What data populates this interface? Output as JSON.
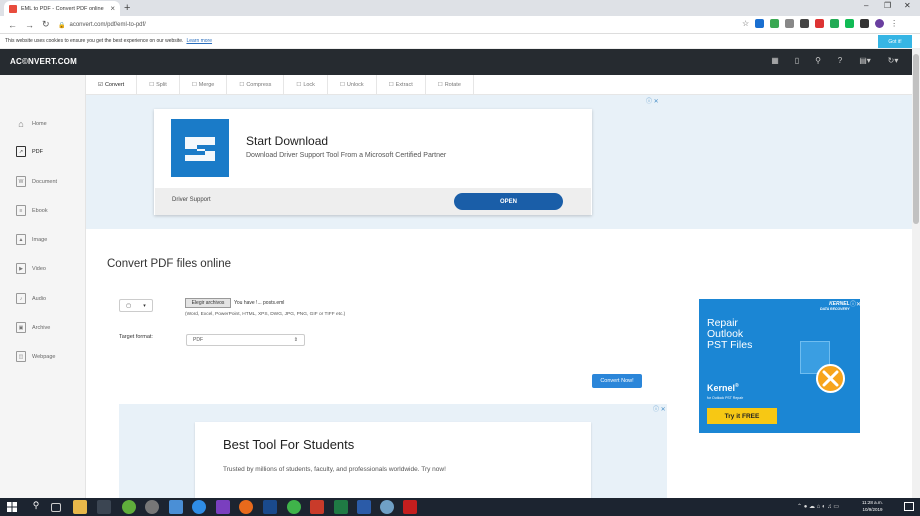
{
  "browser": {
    "tab_title": "EML to PDF - Convert PDF online",
    "url": "aconvert.com/pdf/eml-to-pdf/",
    "new_tab_icon": "plus-icon",
    "window_controls": [
      "minimize-icon",
      "restore-icon",
      "close-icon"
    ]
  },
  "cookie": {
    "text": "This website uses cookies to ensure you get the best experience on our website.",
    "link": "Learn more",
    "button": "Got it!"
  },
  "site": {
    "logo": "AC©NVERT.COM",
    "header_icons": [
      "grid-icon",
      "tablet-icon",
      "search-icon",
      "help-icon",
      "file-dropdown-icon",
      "refresh-dropdown-icon"
    ]
  },
  "sidebar": {
    "items": [
      {
        "label": "Home",
        "icon": "home-icon"
      },
      {
        "label": "PDF",
        "icon": "pdf-icon"
      },
      {
        "label": "Document",
        "icon": "document-icon"
      },
      {
        "label": "Ebook",
        "icon": "ebook-icon"
      },
      {
        "label": "Image",
        "icon": "image-icon"
      },
      {
        "label": "Video",
        "icon": "video-icon"
      },
      {
        "label": "Audio",
        "icon": "audio-icon"
      },
      {
        "label": "Archive",
        "icon": "archive-icon"
      },
      {
        "label": "Webpage",
        "icon": "webpage-icon"
      }
    ],
    "active": "PDF"
  },
  "tooltabs": [
    {
      "label": "Convert",
      "checked": true
    },
    {
      "label": "Split",
      "checked": false
    },
    {
      "label": "Merge",
      "checked": false
    },
    {
      "label": "Compress",
      "checked": false
    },
    {
      "label": "Lock",
      "checked": false
    },
    {
      "label": "Unlock",
      "checked": false
    },
    {
      "label": "Extract",
      "checked": false
    },
    {
      "label": "Rotate",
      "checked": false
    }
  ],
  "ad_top": {
    "title": "Start Download",
    "subtitle": "Download Driver Support Tool From a Microsoft Certified Partner",
    "sponsor": "Driver Support",
    "cta": "OPEN"
  },
  "main": {
    "heading": "Convert PDF files online",
    "choose_button": "Elegir archivos",
    "file_name": "You have !... posts.eml",
    "formats_note": "(Word, Excel, PowerPoint, HTML, XPS, DWG, JPG, PNG, GIF or TIFF etc.)",
    "target_label": "Target format:",
    "target_value": "PDF",
    "convert_button": "Convert Now!"
  },
  "ad_right": {
    "brand": "KERNEL",
    "brand_sub": "DATA RECOVERY",
    "headline_1": "Repair",
    "headline_2": "Outlook",
    "headline_3": "PST Files",
    "name": "Kernel",
    "name_sup": "®",
    "sub": "for Outlook PST Repair",
    "cta": "Try it FREE"
  },
  "ad_bottom": {
    "title": "Best Tool For Students",
    "subtitle": "Trusted by millions of students, faculty, and professionals worldwide. Try now!"
  },
  "taskbar": {
    "time": "11:28 a.m.",
    "date": "10/9/2019"
  },
  "colors": {
    "header_bg": "#262b30",
    "accent": "#2b86d9",
    "ad_blue": "#1b86d4",
    "cta_yellow": "#f7c814"
  }
}
